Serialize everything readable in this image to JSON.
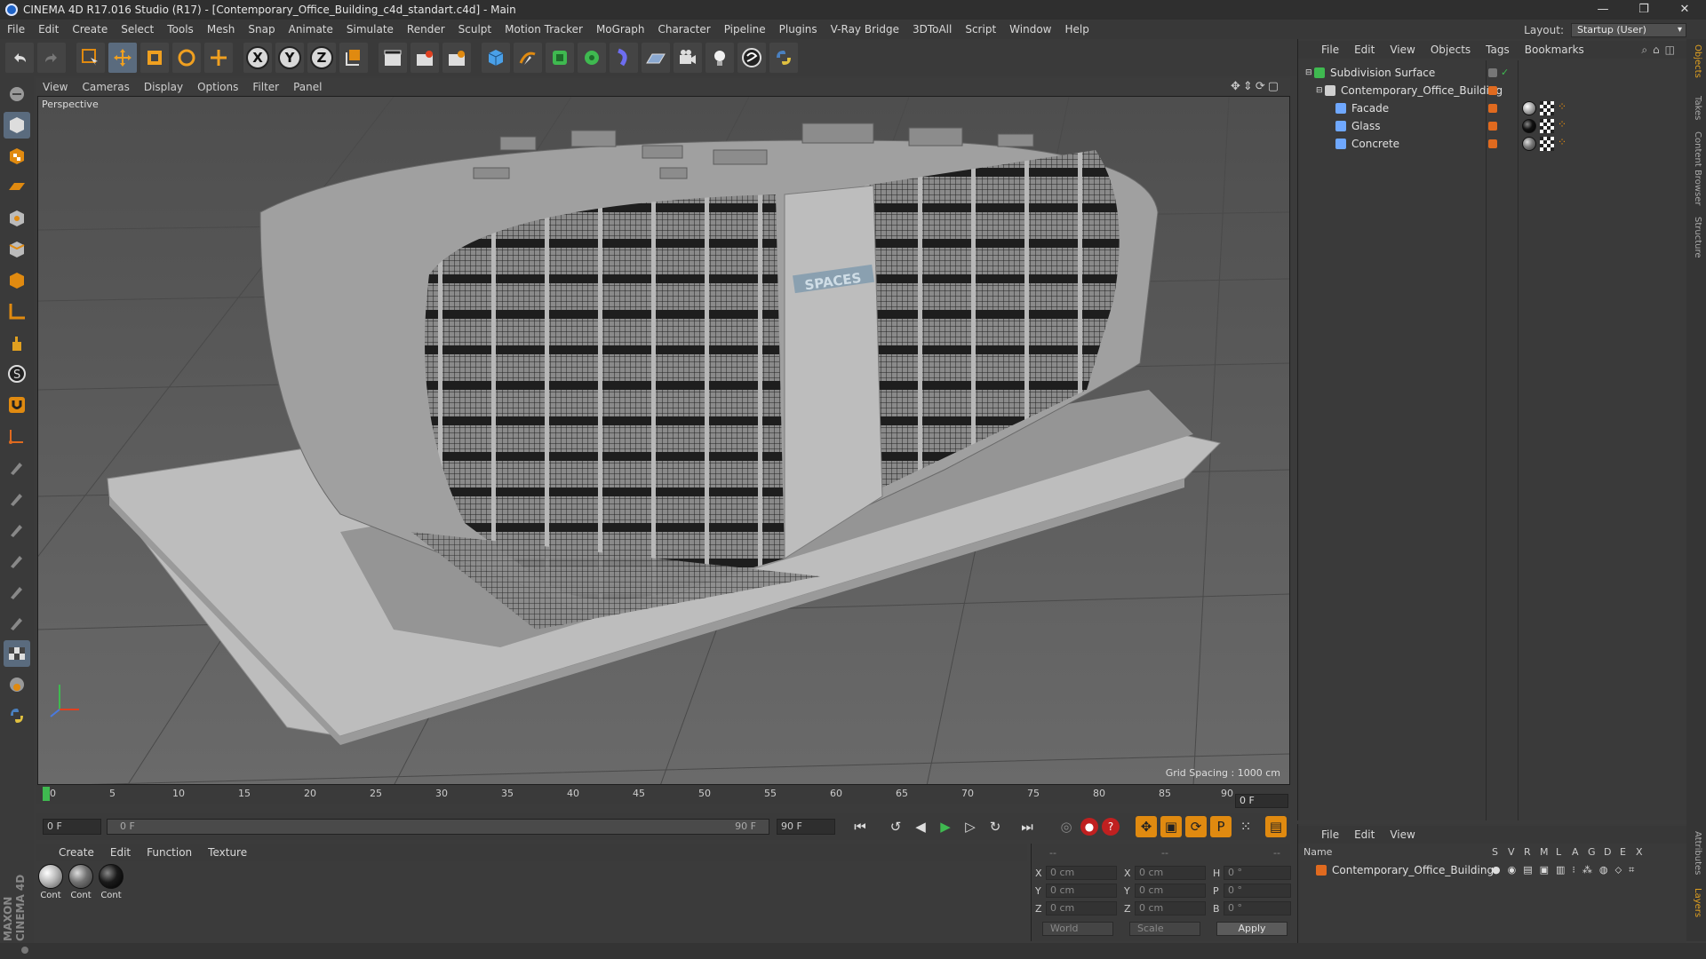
{
  "window": {
    "title": "CINEMA 4D R17.016 Studio (R17) - [Contemporary_Office_Building_c4d_standart.c4d] - Main",
    "controls": [
      "—",
      "❐",
      "✕"
    ]
  },
  "menu": [
    "File",
    "Edit",
    "Create",
    "Select",
    "Tools",
    "Mesh",
    "Snap",
    "Animate",
    "Simulate",
    "Render",
    "Sculpt",
    "Motion Tracker",
    "MoGraph",
    "Character",
    "Pipeline",
    "Plugins",
    "V-Ray Bridge",
    "3DToAll",
    "Script",
    "Window",
    "Help"
  ],
  "layout": {
    "label": "Layout:",
    "value": "Startup (User)"
  },
  "toolbar": {
    "axes": [
      "X",
      "Y",
      "Z"
    ]
  },
  "viewport": {
    "menu": [
      "View",
      "Cameras",
      "Display",
      "Options",
      "Filter",
      "Panel"
    ],
    "label": "Perspective",
    "grid_spacing": "Grid Spacing : 1000 cm",
    "sign": "SPACES"
  },
  "timeline": {
    "ticks": [
      "0",
      "5",
      "10",
      "15",
      "20",
      "25",
      "30",
      "35",
      "40",
      "45",
      "50",
      "55",
      "60",
      "65",
      "70",
      "75",
      "80",
      "85",
      "90"
    ],
    "current": "0 F"
  },
  "playbar": {
    "start": "0 F",
    "range_start": "0 F",
    "range_end": "90 F",
    "end": "90 F"
  },
  "materials": {
    "menu": [
      "Create",
      "Edit",
      "Function",
      "Texture"
    ],
    "items": [
      {
        "name": "Cont",
        "color": "#b8b8b8"
      },
      {
        "name": "Cont",
        "color": "#707070"
      },
      {
        "name": "Cont",
        "color": "#1a1a1a"
      }
    ]
  },
  "coords": {
    "header": [
      "--",
      "--",
      "--"
    ],
    "rows": [
      {
        "a": "X",
        "v1": "0 cm",
        "b": "X",
        "v2": "0 cm",
        "c": "H",
        "v3": "0 °"
      },
      {
        "a": "Y",
        "v1": "0 cm",
        "b": "Y",
        "v2": "0 cm",
        "c": "P",
        "v3": "0 °"
      },
      {
        "a": "Z",
        "v1": "0 cm",
        "b": "Z",
        "v2": "0 cm",
        "c": "B",
        "v3": "0 °"
      }
    ],
    "world": "World",
    "scale": "Scale",
    "apply": "Apply"
  },
  "objects": {
    "menu": [
      "File",
      "Edit",
      "View",
      "Objects",
      "Tags",
      "Bookmarks"
    ],
    "items": [
      {
        "name": "Subdivision Surface",
        "indent": 0,
        "icon": "#3fb950"
      },
      {
        "name": "Contemporary_Office_Building",
        "indent": 1,
        "icon": "#cfcfcf"
      },
      {
        "name": "Facade",
        "indent": 2,
        "icon": "#6fa8ff"
      },
      {
        "name": "Glass",
        "indent": 2,
        "icon": "#6fa8ff"
      },
      {
        "name": "Concrete",
        "indent": 2,
        "icon": "#6fa8ff"
      }
    ]
  },
  "layers": {
    "menu": [
      "File",
      "Edit",
      "View"
    ],
    "header": {
      "name": "Name",
      "cols": [
        "S",
        "V",
        "R",
        "M",
        "L",
        "A",
        "G",
        "D",
        "E",
        "X"
      ]
    },
    "row": "Contemporary_Office_Building"
  },
  "sidetabs": [
    "Objects",
    "Takes",
    "Content Browser",
    "Structure",
    "Attributes",
    "Layers"
  ],
  "brand": "MAXON CINEMA 4D",
  "colors": {
    "accent": "#e06a1f",
    "selected": "#5a6b7e"
  }
}
